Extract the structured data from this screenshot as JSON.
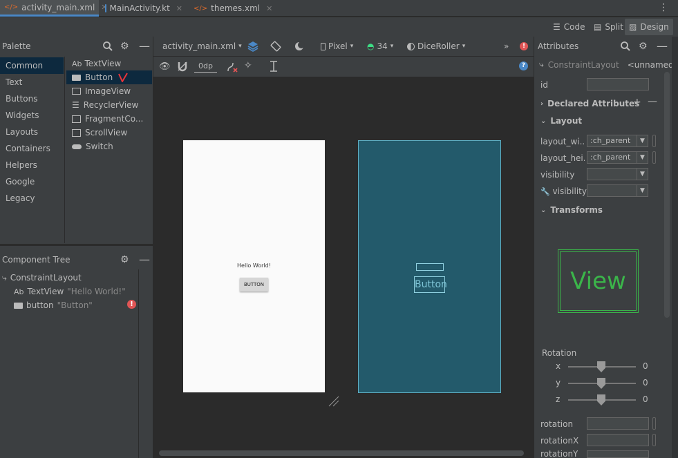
{
  "tabs": [
    {
      "label": "activity_main.xml",
      "icon": "xml-file-icon",
      "active": true
    },
    {
      "label": "MainActivity.kt",
      "icon": "kotlin-file-icon",
      "active": false
    },
    {
      "label": "themes.xml",
      "icon": "xml-file-icon",
      "active": false
    }
  ],
  "modes": {
    "code": "Code",
    "split": "Split",
    "design": "Design"
  },
  "palette": {
    "title": "Palette",
    "categories": [
      "Common",
      "Text",
      "Buttons",
      "Widgets",
      "Layouts",
      "Containers",
      "Helpers",
      "Google",
      "Legacy"
    ],
    "items": [
      {
        "prefix": "Ab",
        "label": "TextView"
      },
      {
        "prefix": "",
        "label": "Button"
      },
      {
        "prefix": "",
        "label": "ImageView"
      },
      {
        "prefix": "",
        "label": "RecyclerView"
      },
      {
        "prefix": "",
        "label": "FragmentCo..."
      },
      {
        "prefix": "",
        "label": "ScrollView"
      },
      {
        "prefix": "",
        "label": "Switch"
      }
    ]
  },
  "toolbar": {
    "file": "activity_main.xml",
    "device": "Pixel",
    "api": "34",
    "theme": "DiceRoller",
    "margin": "0dp"
  },
  "component_tree": {
    "title": "Component Tree",
    "root": "ConstraintLayout",
    "children": [
      {
        "prefix": "Ab",
        "name": "TextView",
        "value": "\"Hello World!\""
      },
      {
        "prefix": "",
        "name": "button",
        "value": "\"Button\""
      }
    ]
  },
  "preview": {
    "hello": "Hello World!",
    "button": "BUTTON",
    "blueprint_button": "Button"
  },
  "attributes": {
    "title": "Attributes",
    "component": "ConstraintLayout",
    "component_name": "<unnamed>",
    "id_label": "id",
    "declared": "Declared Attributes",
    "layout": "Layout",
    "rows": [
      {
        "label": "layout_wi...",
        "value": ":ch_parent"
      },
      {
        "label": "layout_hei...",
        "value": ":ch_parent"
      },
      {
        "label": "visibility",
        "value": ""
      },
      {
        "label": "visibility",
        "value": ""
      }
    ],
    "transforms": "Transforms",
    "view_label": "View",
    "rotation_title": "Rotation",
    "rotation_axes": [
      {
        "axis": "x",
        "value": "0"
      },
      {
        "axis": "y",
        "value": "0"
      },
      {
        "axis": "z",
        "value": "0"
      }
    ],
    "bottom_rows": [
      "rotation",
      "rotationX",
      "rotationY"
    ]
  }
}
